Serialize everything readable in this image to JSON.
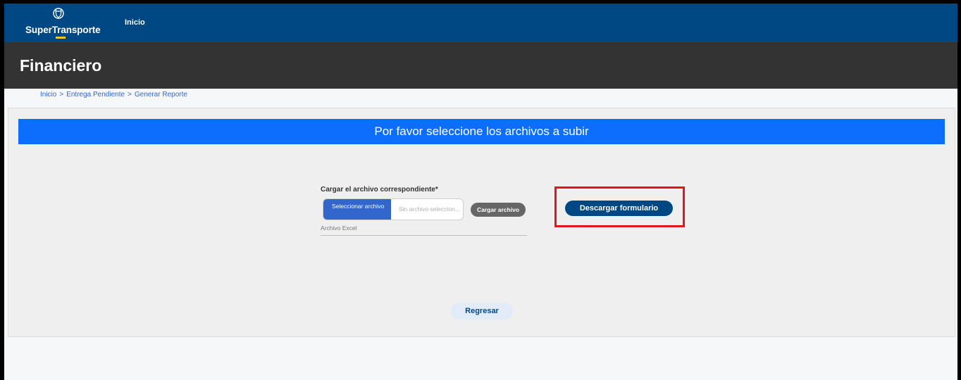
{
  "header": {
    "logo_text": "SuperTransporte",
    "nav_inicio": "Inicio"
  },
  "page": {
    "title": "Financiero"
  },
  "breadcrumb": {
    "items": [
      "Inicio",
      "Entrega Pendiente",
      "Generar Reporte"
    ],
    "separator": ">"
  },
  "banner": {
    "text": "Por favor seleccione los archivos a subir"
  },
  "upload": {
    "label": "Cargar el archivo correspondiente*",
    "select_button": "Seleccionar archivo",
    "file_name": "Sin archivo seleccion...",
    "upload_button": "Cargar archivo",
    "hint": "Archivo Excel"
  },
  "actions": {
    "download_button": "Descargar formulario",
    "back_button": "Regresar"
  },
  "colors": {
    "header_bg": "#004884",
    "title_bar_bg": "#333333",
    "banner_bg": "#0d6efd",
    "highlight_border": "#e3141b"
  }
}
